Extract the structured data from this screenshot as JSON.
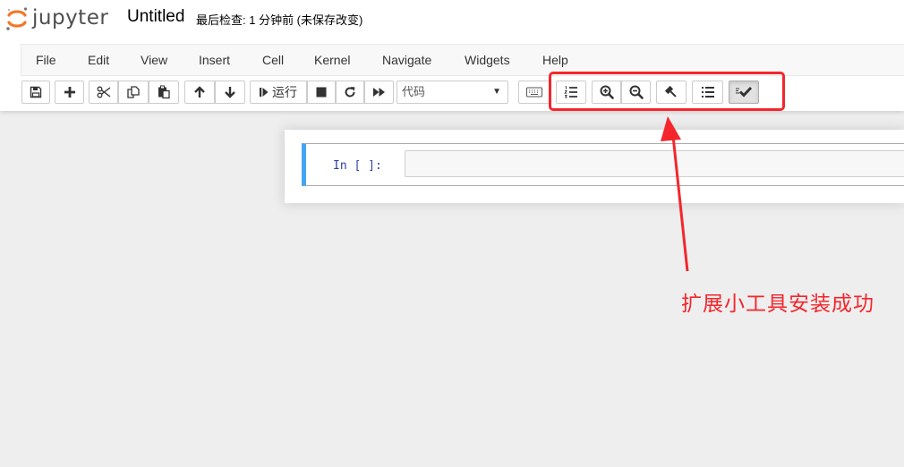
{
  "header": {
    "logo_text": "jupyter",
    "notebook_name": "Untitled",
    "checkpoint_text": "最后检查: 1 分钟前  (未保存改变)"
  },
  "menu": [
    "File",
    "Edit",
    "View",
    "Insert",
    "Cell",
    "Kernel",
    "Navigate",
    "Widgets",
    "Help"
  ],
  "toolbar": {
    "run_label": "运行",
    "cell_type_selected": "代码"
  },
  "cell": {
    "prompt": "In [ ]:"
  },
  "annotation": {
    "text": "扩展小工具安装成功",
    "color": "#f4262c"
  },
  "colors": {
    "accent": "#42a5f5",
    "logo_orange": "#f37726",
    "annotation": "#f4262c"
  },
  "icons": {
    "toolbar_main": [
      "save-icon",
      "plus-icon",
      "scissors-icon",
      "copy-icon",
      "paste-icon",
      "arrow-up-icon",
      "arrow-down-icon",
      "step-forward-icon",
      "stop-icon",
      "refresh-icon",
      "fast-forward-icon",
      "keyboard-icon"
    ],
    "toolbar_extensions": [
      "ordered-list-icon",
      "zoom-in-icon",
      "zoom-out-icon",
      "gavel-icon",
      "list-icon",
      "check-icon"
    ]
  }
}
